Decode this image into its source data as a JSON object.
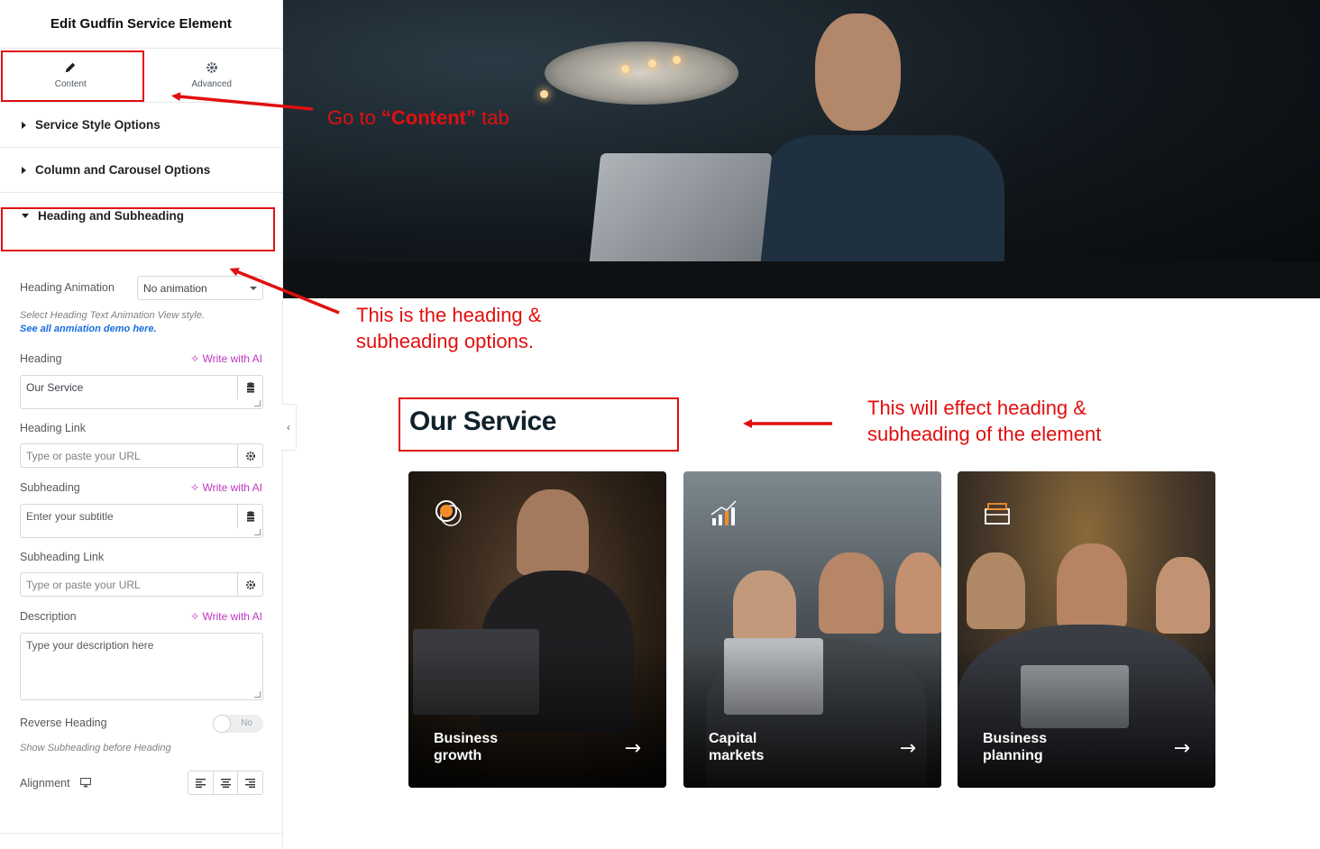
{
  "panel": {
    "title": "Edit Gudfin Service Element",
    "tabs": [
      {
        "label": "Content",
        "icon": "pencil-icon"
      },
      {
        "label": "Advanced",
        "icon": "gear-icon"
      }
    ],
    "sections": [
      {
        "label": "Service Style Options",
        "state": "collapsed"
      },
      {
        "label": "Column and Carousel Options",
        "state": "collapsed"
      },
      {
        "label": "Heading and Subheading",
        "state": "expanded"
      }
    ],
    "heading_animation": {
      "label": "Heading Animation",
      "value": "No animation",
      "hint": "Select Heading Text Animation View style.",
      "hint_link": "See all anmiation demo here."
    },
    "heading": {
      "label": "Heading",
      "ai": "Write with AI",
      "value": "Our Service"
    },
    "heading_link": {
      "label": "Heading Link",
      "placeholder": "Type or paste your URL"
    },
    "subheading": {
      "label": "Subheading",
      "ai": "Write with AI",
      "placeholder": "Enter your subtitle"
    },
    "subheading_link": {
      "label": "Subheading Link",
      "placeholder": "Type or paste your URL"
    },
    "description": {
      "label": "Description",
      "ai": "Write with AI",
      "placeholder": "Type your description here"
    },
    "reverse_heading": {
      "label": "Reverse Heading",
      "toggle": "No",
      "hint": "Show Subheading before Heading"
    },
    "alignment": {
      "label": "Alignment",
      "options": [
        "left",
        "center",
        "right"
      ]
    },
    "collapse_glyph": "‹"
  },
  "annotations": {
    "content_tab": {
      "prefix": "Go  to ",
      "strong": "“Content”",
      "suffix": " tab"
    },
    "options": {
      "line1": "This is the heading &",
      "line2": "subheading options."
    },
    "effect": {
      "line1": "This will effect heading &",
      "line2": "subheading of the element"
    },
    "color": "#e10f0f"
  },
  "preview": {
    "title": "Our Service",
    "cards": [
      {
        "title_line1": "Business",
        "title_line2": "growth",
        "icon": "coins-icon",
        "arrow": "→"
      },
      {
        "title_line1": "Capital",
        "title_line2": "markets",
        "icon": "chart-growth-icon",
        "arrow": "→"
      },
      {
        "title_line1": "Business",
        "title_line2": "planning",
        "icon": "wallet-icon",
        "arrow": "→"
      }
    ]
  }
}
